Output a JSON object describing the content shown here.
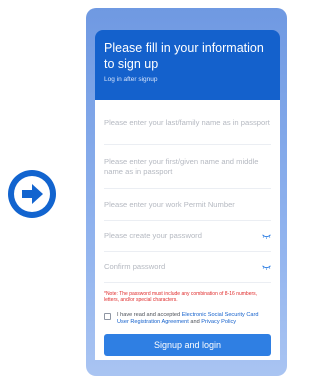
{
  "header": {
    "title": "Please fill in your information to sign up",
    "subtitle": "Log in after signup"
  },
  "form": {
    "last_name_placeholder": "Please enter your last/family name as in passport",
    "first_name_placeholder": "Please enter your first/given name and middle name as in passport",
    "permit_placeholder": "Please enter your work Permit Number",
    "password_placeholder": "Please create your password",
    "confirm_placeholder": "Confirm password",
    "password_note": "*Note: The password must include any combination of 8-16 numbers, letters, and/or special characters.",
    "agreement": {
      "prefix": "I have read and accepted ",
      "link1": "Electronic Social Security Card User Registration Agreement",
      "middle": " and ",
      "link2": "Privacy Policy",
      "checked": false
    },
    "submit_label": "Signup and login"
  },
  "icons": {
    "next": "arrow-right-circle-icon",
    "eye": "eye-closed-icon"
  },
  "colors": {
    "primary": "#1461cc",
    "button": "#2f7fe3",
    "note": "#e02b2b",
    "background_gradient_top": "#6f99e2"
  }
}
